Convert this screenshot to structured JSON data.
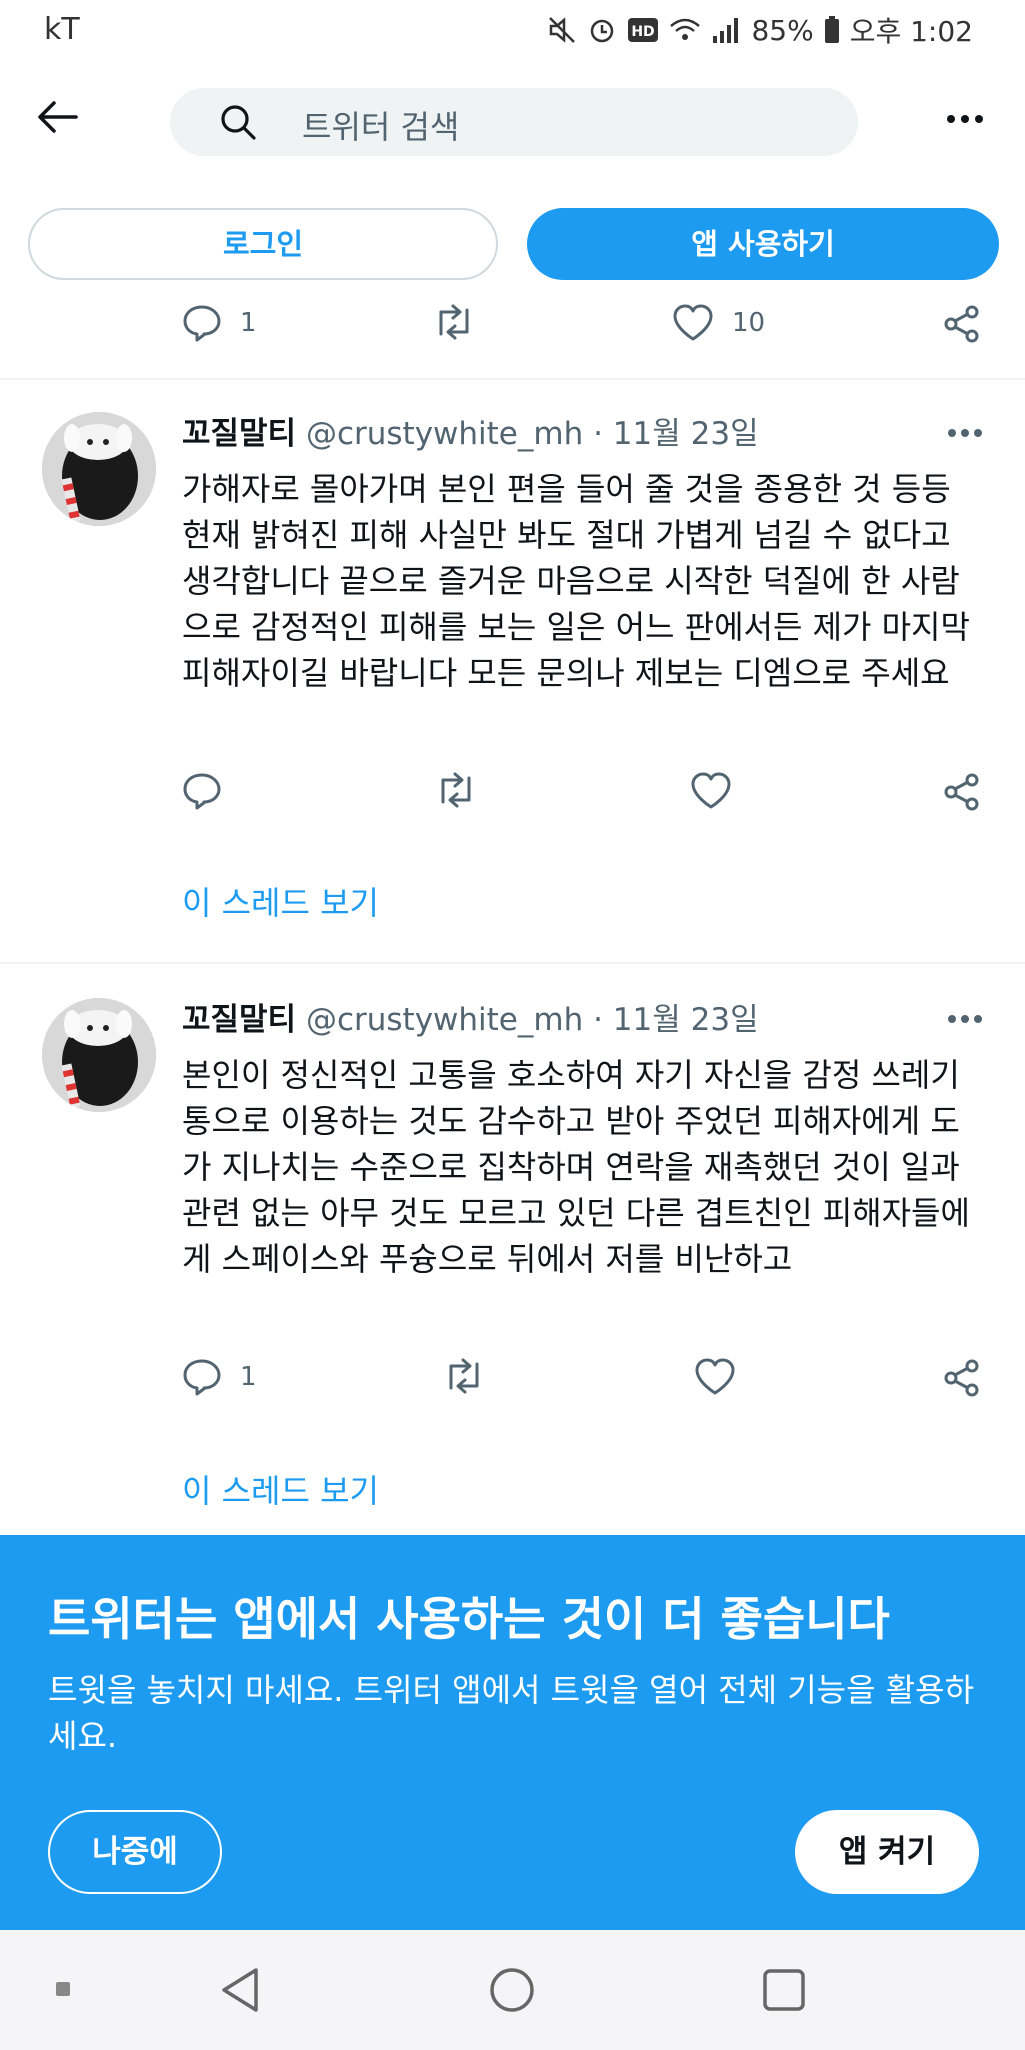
{
  "status_bar": {
    "carrier": "kT",
    "battery": "85%",
    "time": "오후 1:02"
  },
  "search": {
    "placeholder": "트위터 검색"
  },
  "auth": {
    "login_label": "로그인",
    "use_app_label": "앱 사용하기"
  },
  "prev_tweet_actions": {
    "replies": "1",
    "retweets": "",
    "likes": "10"
  },
  "tweets": [
    {
      "name": "꼬질말티",
      "handle": "@crustywhite_mh",
      "date": "· 11월 23일",
      "text": "가해자로 몰아가며 본인 편을 들어 줄 것을 종용한 것 등등 현재 밝혀진 피해 사실만 봐도 절대 가볍게 넘길 수 없다고 생각합니다 끝으로 즐거운 마음으로 시작한 덕질에 한 사람으로 감정적인 피해를 보는 일은 어느 판에서든 제가 마지막 피해자이길 바랍니다 모든 문의나 제보는 디엠으로 주세요",
      "replies": "",
      "likes": "",
      "thread_link": "이 스레드 보기"
    },
    {
      "name": "꼬질말티",
      "handle": "@crustywhite_mh",
      "date": "· 11월 23일",
      "text": "본인이 정신적인 고통을 호소하여 자기 자신을 감정 쓰레기통으로 이용하는 것도 감수하고 받아 주었던 피해자에게 도가 지나치는 수준으로 집착하며 연락을 재촉했던 것이 일과 관련 없는 아무 것도 모르고 있던 다른 겹트친인 피해자들에게 스페이스와 푸슝으로 뒤에서 저를 비난하고",
      "replies": "1",
      "likes": "",
      "thread_link": "이 스레드 보기"
    }
  ],
  "banner": {
    "title": "트위터는 앱에서 사용하는 것이 더 좋습니다",
    "subtitle": "트윗을 놓치지 마세요. 트위터 앱에서 트윗을 열어 전체 기능을 활용하세요.",
    "later_label": "나중에",
    "open_label": "앱 켜기"
  },
  "colors": {
    "accent": "#1d9bf0",
    "text": "#0f1419",
    "secondary": "#536471"
  },
  "icons": [
    "back-arrow-icon",
    "search-icon",
    "more-icon",
    "reply-icon",
    "retweet-icon",
    "like-icon",
    "share-icon"
  ]
}
